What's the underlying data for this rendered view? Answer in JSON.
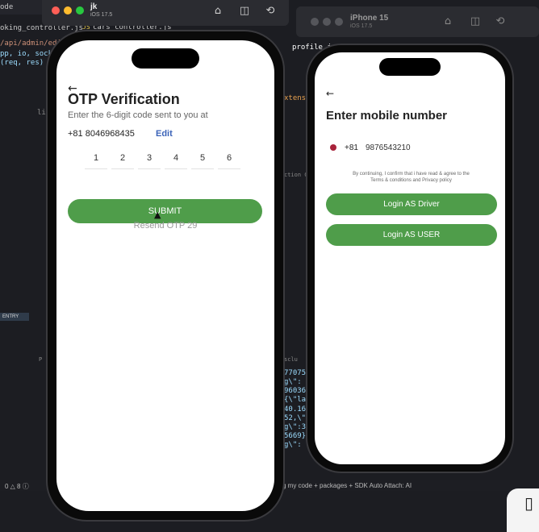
{
  "editor": {
    "tab_mode": "ode",
    "tab_booking": "oking_controller.js",
    "tab_js": "JS",
    "tab_cars": "cars_controller.js",
    "tab_profile": "profile.js",
    "path_line": "/api/admin/edit_",
    "code_line1": "pp, io, socke",
    "code_line2": "(req, res) =",
    "side_lib": "lib",
    "right_line1": "77075",
    "right_line2": "g\\\":",
    "right_line3": "960364",
    "right_line4": "{\\\"la",
    "right_line5": "40.16",
    "right_line6": "52,\\\"",
    "right_line7": "g\\\":35.",
    "right_line8": "5669}",
    "right_line9": "g\\\":",
    "extension_label": "xtensio",
    "action_label": "ction C",
    "panel_label": "P",
    "panel_label2": "sclu",
    "entry_label": "ENTRY",
    "status_left": "0 △ 8 ⓘ",
    "status_right": "g my code + packages + SDK    Auto Attach: AI"
  },
  "sim_left": {
    "device_name": "jk",
    "os_version": "iOS 17.5",
    "home_icon": "home-icon",
    "screenshot_icon": "screenshot-icon",
    "rotate_icon": "rotate-icon"
  },
  "sim_right": {
    "device_name": "iPhone 15",
    "os_version": "iOS 17.5",
    "home_icon": "home-icon",
    "screenshot_icon": "screenshot-icon",
    "rotate_icon": "rotate-icon"
  },
  "otp_screen": {
    "back_icon": "back-arrow-icon",
    "title": "OTP Verification",
    "subtitle": "Enter the 6-digit code sent to you at",
    "phone": "+81 8046968435",
    "edit_label": "Edit",
    "digits": [
      "1",
      "2",
      "3",
      "4",
      "5",
      "6"
    ],
    "submit_label": "SUBMIT",
    "resend_label": "Resend OTP  29"
  },
  "mobile_screen": {
    "back_icon": "back-arrow-icon",
    "title": "Enter mobile number",
    "country_code": "+81",
    "mobile_number": "9876543210",
    "terms_line1": "By continuing, I confirm that i have read & agree to the",
    "terms_line2": "Terms & conditions and Privacy policy",
    "driver_button": "Login AS Driver",
    "user_button": "Login AS USER"
  },
  "colors": {
    "accent_green": "#4f9d4a",
    "edit_link": "#3b63b8",
    "flag_red": "#a8223a"
  }
}
